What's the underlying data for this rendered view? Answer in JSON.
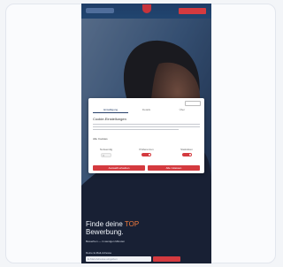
{
  "cookie": {
    "tabs": [
      "Einwilligung",
      "Details",
      "Über"
    ],
    "title": "Cookie-Einstellungen",
    "section": "Alle Cookies",
    "toggles": [
      {
        "label": "Notwendig",
        "on": false
      },
      {
        "label": "Präferenzen",
        "on": true
      },
      {
        "label": "Statistiken",
        "on": true
      }
    ],
    "buttons": [
      "Auswahl erlauben",
      "Alle zulassen"
    ]
  },
  "hero": {
    "headline_prefix": "Finde deine",
    "headline_accent": "TOP",
    "headline_suffix": "Bewerbung.",
    "subline": "Bewerben — in wenigen Minuten",
    "input_label": "Deine E-Mail-Adresse",
    "input_placeholder": "E-Mail-Adresse eingeben"
  },
  "colors": {
    "brand_red": "#d43a3f",
    "navy": "#21456f"
  }
}
